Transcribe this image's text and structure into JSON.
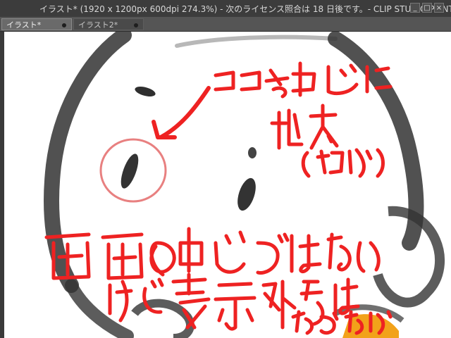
{
  "window": {
    "title": "イラスト* (1920 x 1200px 600dpi 274.3%)   - 次のライセンス照合は 18 日後です。- CLIP STUDIO PAINT EX",
    "controls": {
      "minimize": "_",
      "maximize": "□",
      "close": "×"
    }
  },
  "tabs": [
    {
      "label": "イラスト*",
      "active": true
    },
    {
      "label": "イラスト2*",
      "active": false
    }
  ],
  "tab_menu": "▾",
  "colors": {
    "annotation_red": "#ee2222",
    "ink": "#333333",
    "circle_pink": "#e88080",
    "accent_orange": "#f2a21a"
  }
}
